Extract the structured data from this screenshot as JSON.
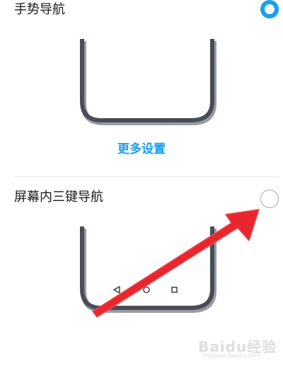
{
  "options": [
    {
      "label": "手势导航",
      "selected": true
    },
    {
      "label": "屏幕内三键导航",
      "selected": false,
      "nav_keys": [
        "back-triangle-icon",
        "home-circle-icon",
        "recent-square-icon"
      ]
    }
  ],
  "more_settings_label": "更多设置",
  "colors": {
    "accent": "#1aa0f0",
    "phone_outline": "#4a4d57",
    "arrow": "#e8262d"
  },
  "watermark": {
    "text": "Baidu经验",
    "subtext": "jingyan.baidu.com"
  }
}
